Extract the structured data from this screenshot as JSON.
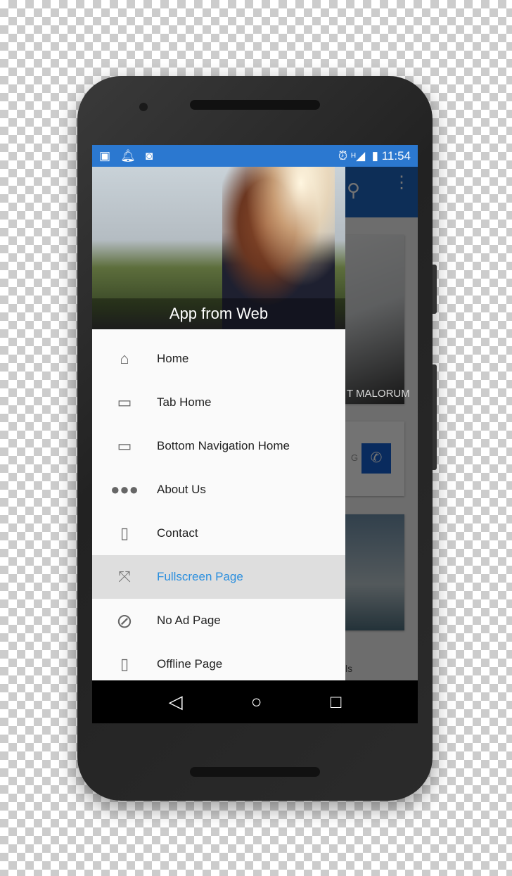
{
  "status_bar": {
    "time": "11:54",
    "network": "H",
    "icons": [
      "image-icon",
      "bell-icon",
      "android-icon",
      "alarm-icon",
      "signal-icon",
      "battery-charging-icon"
    ]
  },
  "app_bar": {
    "icons": [
      "search-icon",
      "more-vert-icon"
    ]
  },
  "background_content": {
    "card1_caption": "T MALORUM",
    "card2_text": "G",
    "card3_text": "ls"
  },
  "drawer": {
    "header_title": "App from Web",
    "items": [
      {
        "label": "Home",
        "icon": "home-icon"
      },
      {
        "label": "Tab Home",
        "icon": "tab-icon"
      },
      {
        "label": "Bottom Navigation Home",
        "icon": "bottom-navigation-icon"
      },
      {
        "label": "About Us",
        "icon": "people-icon"
      },
      {
        "label": "Contact",
        "icon": "contact-book-icon"
      },
      {
        "label": "Fullscreen Page",
        "icon": "fullscreen-icon",
        "selected": true
      },
      {
        "label": "No Ad Page",
        "icon": "block-icon"
      },
      {
        "label": "Offline Page",
        "icon": "phone-data-icon"
      }
    ]
  },
  "colors": {
    "status_bar": "#2b78d0",
    "app_bar": "#1d67c0",
    "selected_text": "#2b8fde",
    "selected_bg": "#dedede"
  },
  "nav_bar": {
    "icons": [
      "back-icon",
      "home-circle-icon",
      "recents-icon"
    ]
  }
}
